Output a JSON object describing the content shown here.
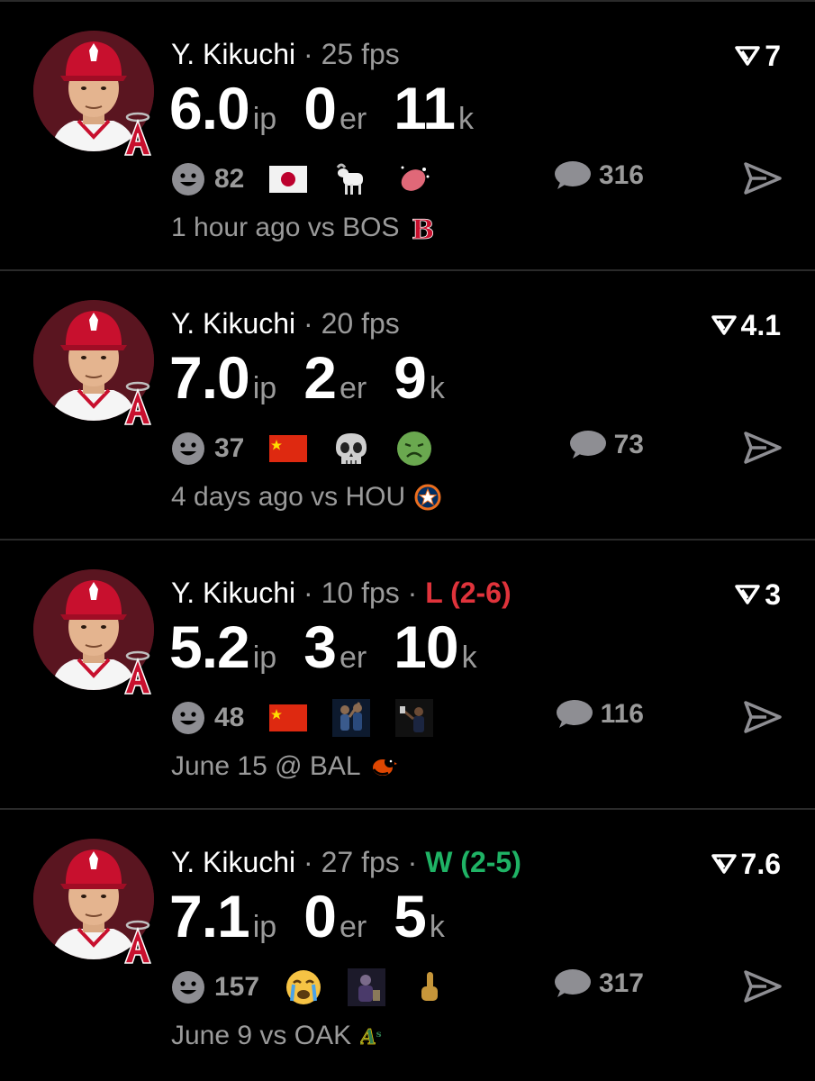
{
  "cards": [
    {
      "name": "Y. Kikuchi",
      "sep": "·",
      "fps": "25 fps",
      "result": "",
      "result_type": "",
      "score": "7",
      "ip": "6.0",
      "ip_unit": "ip",
      "er": "0",
      "er_unit": "er",
      "k": "11",
      "k_unit": "k",
      "reactions": "82",
      "emojis": [
        "japan-flag-icon",
        "goat-icon",
        "sparkling-heart-icon"
      ],
      "comments": "316",
      "when": "1 hour ago vs BOS",
      "opponent_logo": "red-sox-logo-icon"
    },
    {
      "name": "Y. Kikuchi",
      "sep": "·",
      "fps": "20 fps",
      "result": "",
      "result_type": "",
      "score": "4.1",
      "ip": "7.0",
      "ip_unit": "ip",
      "er": "2",
      "er_unit": "er",
      "k": "9",
      "k_unit": "k",
      "reactions": "37",
      "emojis": [
        "china-flag-icon",
        "skull-icon",
        "nauseated-face-icon"
      ],
      "comments": "73",
      "when": "4 days ago vs HOU",
      "opponent_logo": "astros-logo-icon"
    },
    {
      "name": "Y. Kikuchi",
      "sep": "·",
      "fps": "10 fps",
      "sep2": "·",
      "result": "L (2-6)",
      "result_type": "loss",
      "score": "3",
      "ip": "5.2",
      "ip_unit": "ip",
      "er": "3",
      "er_unit": "er",
      "k": "10",
      "k_unit": "k",
      "reactions": "48",
      "emojis": [
        "china-flag-icon",
        "players-celebrating-icon",
        "player-selfie-icon"
      ],
      "comments": "116",
      "when": "June 15 @ BAL",
      "opponent_logo": "orioles-logo-icon"
    },
    {
      "name": "Y. Kikuchi",
      "sep": "·",
      "fps": "27 fps",
      "sep2": "·",
      "result": "W (2-5)",
      "result_type": "win",
      "score": "7.6",
      "ip": "7.1",
      "ip_unit": "ip",
      "er": "0",
      "er_unit": "er",
      "k": "5",
      "k_unit": "k",
      "reactions": "157",
      "emojis": [
        "crying-face-icon",
        "sad-person-icon",
        "middle-finger-icon"
      ],
      "comments": "317",
      "when": "June 9 vs OAK",
      "opponent_logo": "athletics-logo-icon"
    }
  ],
  "colors": {
    "loss": "#e0333b",
    "win": "#1fb365",
    "muted": "#9a9a9a",
    "divider": "#2a2a2a"
  }
}
